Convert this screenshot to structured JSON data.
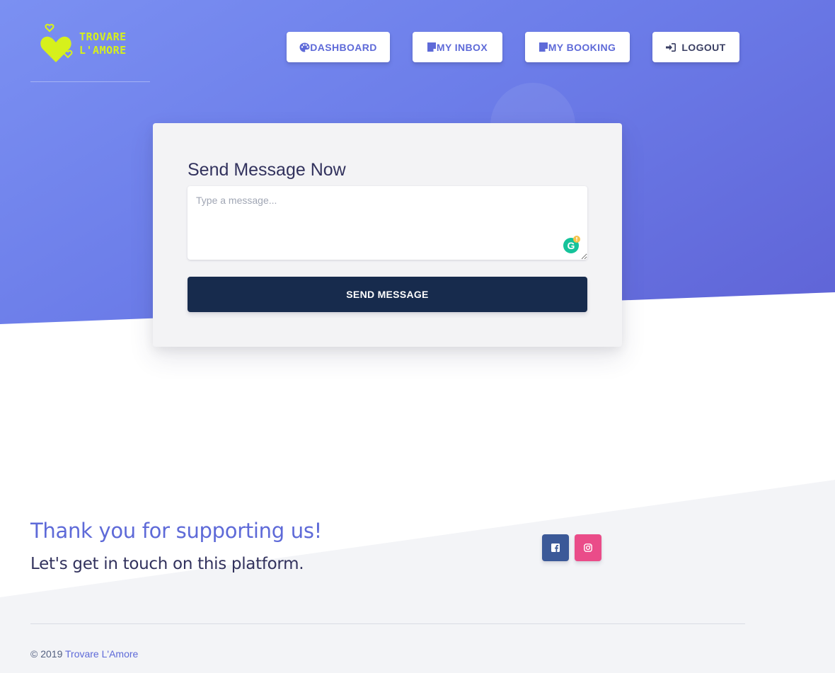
{
  "brand": {
    "logo_line1": "TROVARE",
    "logo_line2": "L'AMORE",
    "logo_color": "#d6f01c"
  },
  "nav": {
    "items": [
      {
        "label": "DASHBOARD",
        "icon": "palette-icon"
      },
      {
        "label": "MY INBOX",
        "icon": "note-icon"
      },
      {
        "label": "MY BOOKING",
        "icon": "note-icon"
      },
      {
        "label": "LOGOUT",
        "icon": "sign-in-icon"
      }
    ]
  },
  "message_card": {
    "title": "Send Message Now",
    "placeholder": "Type a message...",
    "value": "",
    "send_label": "SEND MESSAGE"
  },
  "footer": {
    "thanks": "Thank you for supporting us!",
    "touch": "Let's get in touch on this platform.",
    "social": [
      {
        "name": "facebook",
        "icon": "facebook-icon",
        "color": "#3b5998"
      },
      {
        "name": "instagram",
        "icon": "instagram-icon",
        "color": "#ea4c89"
      }
    ],
    "copyright_prefix": "© 2019",
    "copyright_link": "Trovare L'Amore"
  },
  "colors": {
    "accent": "#5e6ad8",
    "dark": "#172b4d",
    "hero_gradient_start": "#7b90f2",
    "hero_gradient_end": "#5f63d6"
  }
}
